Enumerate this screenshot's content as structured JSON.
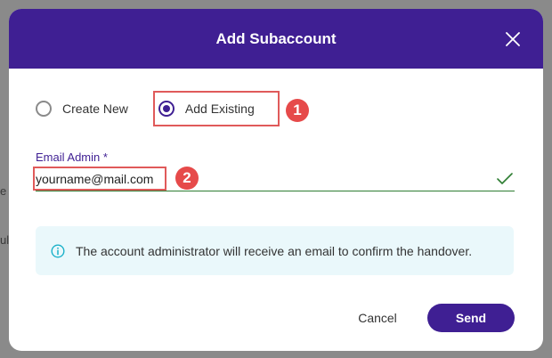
{
  "background": {
    "frag1": "e",
    "frag2": "ul"
  },
  "modal": {
    "title": "Add Subaccount",
    "close_icon": "close-icon",
    "options": [
      {
        "label": "Create New",
        "selected": false
      },
      {
        "label": "Add Existing",
        "selected": true
      }
    ],
    "email": {
      "label": "Email Admin *",
      "value": "yourname@mail.com",
      "valid": true
    },
    "info": {
      "icon": "info-icon",
      "text": "The account administrator will receive an email to confirm the handover."
    },
    "buttons": {
      "cancel": "Cancel",
      "send": "Send"
    }
  },
  "annotations": {
    "badge1": "1",
    "badge2": "2"
  },
  "colors": {
    "brand": "#3f1f93",
    "highlight": "#e05a5a",
    "badge": "#e64a4a",
    "info_bg": "#eaf8fb",
    "success": "#2e7d32"
  }
}
